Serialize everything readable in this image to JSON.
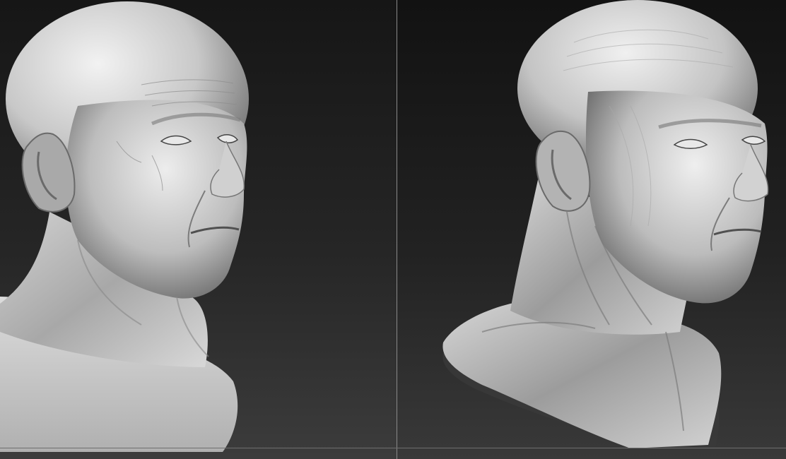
{
  "scene": {
    "description_free": true,
    "panes": [
      {
        "id": "left",
        "render_style": "clay-matcap-detailed-skin"
      },
      {
        "id": "right",
        "render_style": "clay-matcap-sculpted-muscle"
      }
    ]
  },
  "colors": {
    "background_top": "#161616",
    "background_bottom": "#3c3c3c",
    "divider": "#8a8a8a",
    "clay_light": "#e6e6e6",
    "clay_mid": "#b4b4b4",
    "clay_dark": "#5a5a5a"
  }
}
